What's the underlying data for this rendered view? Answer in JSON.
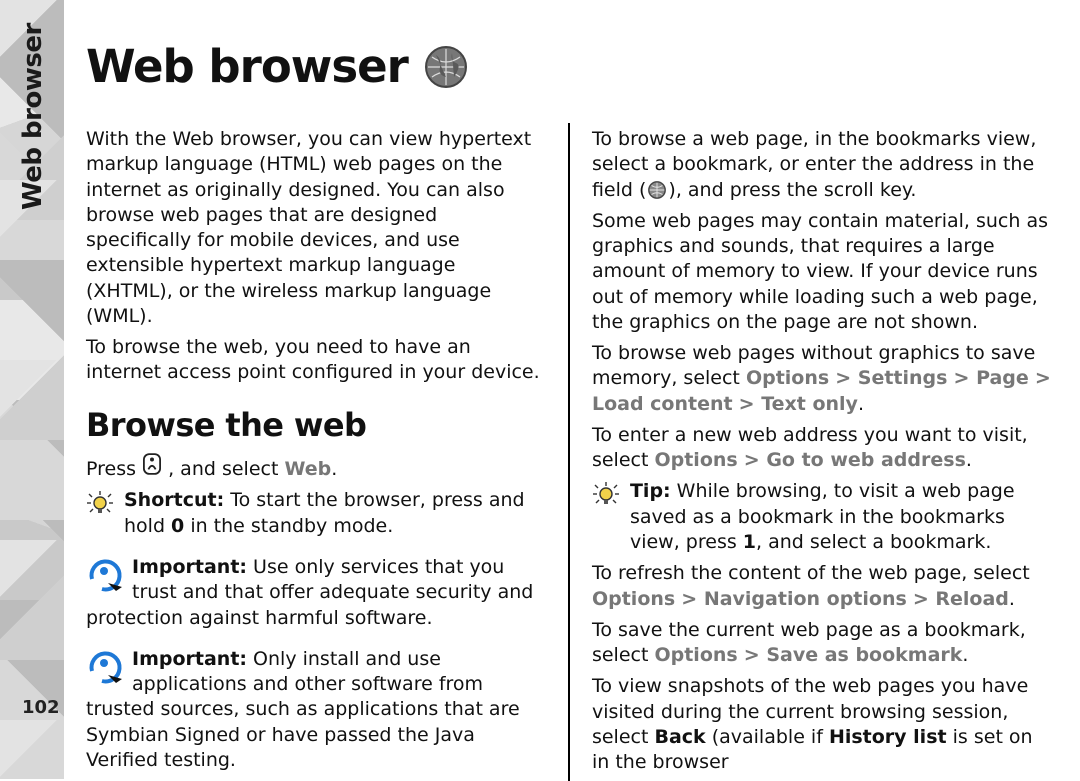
{
  "page_number": "102",
  "side_tab": "Web browser",
  "title": "Web browser",
  "icons": {
    "globe": "globe-icon",
    "home_key": "home-key-icon",
    "tip_bulb": "tip-bulb-icon",
    "important": "important-arrow-icon",
    "address_globe": "address-globe-icon"
  },
  "left": {
    "intro": "With the Web browser, you can view hypertext markup language (HTML) web pages on the internet as originally designed. You can also browse web pages that are designed specifically for mobile devices, and use extensible hypertext markup language (XHTML), or the wireless markup language (WML).",
    "need_ap": "To browse the web, you need to have an internet access point configured in your device.",
    "subheading": "Browse the web",
    "press_prefix": "Press ",
    "press_mid": ", and select ",
    "press_web": "Web",
    "press_suffix": ".",
    "shortcut_label": "Shortcut:",
    "shortcut_body_a": " To start the browser, press and hold ",
    "shortcut_zero": "0",
    "shortcut_body_b": " in the standby mode.",
    "important_label": "Important:",
    "imp1_body": " Use only services that you trust and that offer adequate security and protection against harmful software.",
    "imp2_body": " Only install and use applications and other software from trusted sources, such as applications that are Symbian Signed or have passed the Java Verified testing."
  },
  "right": {
    "p1_a": "To browse a web page, in the bookmarks view, select a bookmark, or enter the address in the field (",
    "p1_b": "), and press the scroll key.",
    "p2": "Some web pages may contain material, such as graphics and sounds, that requires a large amount of memory to view. If your device runs out of memory while loading such a web page, the graphics on the page are not shown.",
    "p3_a": "To browse web pages without graphics to save memory, select ",
    "p3_opts": [
      "Options",
      "Settings",
      "Page",
      "Load content",
      "Text only"
    ],
    "p3_b": ".",
    "p4_a": "To enter a new web address you want to visit, select ",
    "p4_opts": [
      "Options",
      "Go to web address"
    ],
    "p4_b": ".",
    "tip_label": "Tip:",
    "tip_a": " While browsing, to visit a web page saved as a bookmark in the bookmarks view, press ",
    "tip_one": "1",
    "tip_b": ", and select a bookmark.",
    "p5_a": "To refresh the content of the web page, select ",
    "p5_opts": [
      "Options",
      "Navigation options",
      "Reload"
    ],
    "p5_b": ".",
    "p6_a": "To save the current web page as a bookmark, select ",
    "p6_opts": [
      "Options",
      "Save as bookmark"
    ],
    "p6_b": ".",
    "p7_a": "To view snapshots of the web pages you have visited during the current browsing session, select ",
    "p7_back": "Back",
    "p7_b": " (available if ",
    "p7_hist": "History list",
    "p7_c": " is set on in the browser"
  }
}
